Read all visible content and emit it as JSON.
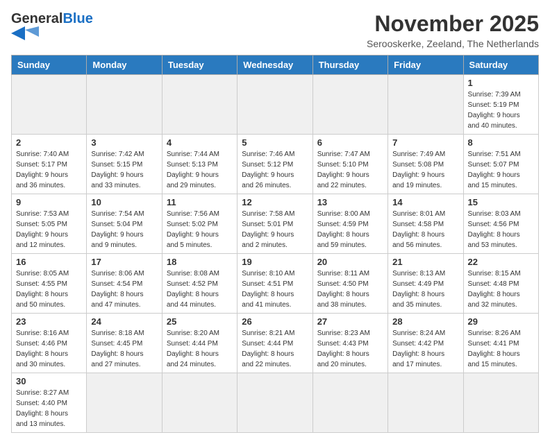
{
  "header": {
    "logo_general": "General",
    "logo_blue": "Blue",
    "title": "November 2025",
    "location": "Serooskerke, Zeeland, The Netherlands"
  },
  "days_of_week": [
    "Sunday",
    "Monday",
    "Tuesday",
    "Wednesday",
    "Thursday",
    "Friday",
    "Saturday"
  ],
  "weeks": [
    [
      {
        "day": "",
        "info": ""
      },
      {
        "day": "",
        "info": ""
      },
      {
        "day": "",
        "info": ""
      },
      {
        "day": "",
        "info": ""
      },
      {
        "day": "",
        "info": ""
      },
      {
        "day": "",
        "info": ""
      },
      {
        "day": "1",
        "info": "Sunrise: 7:39 AM\nSunset: 5:19 PM\nDaylight: 9 hours\nand 40 minutes."
      }
    ],
    [
      {
        "day": "2",
        "info": "Sunrise: 7:40 AM\nSunset: 5:17 PM\nDaylight: 9 hours\nand 36 minutes."
      },
      {
        "day": "3",
        "info": "Sunrise: 7:42 AM\nSunset: 5:15 PM\nDaylight: 9 hours\nand 33 minutes."
      },
      {
        "day": "4",
        "info": "Sunrise: 7:44 AM\nSunset: 5:13 PM\nDaylight: 9 hours\nand 29 minutes."
      },
      {
        "day": "5",
        "info": "Sunrise: 7:46 AM\nSunset: 5:12 PM\nDaylight: 9 hours\nand 26 minutes."
      },
      {
        "day": "6",
        "info": "Sunrise: 7:47 AM\nSunset: 5:10 PM\nDaylight: 9 hours\nand 22 minutes."
      },
      {
        "day": "7",
        "info": "Sunrise: 7:49 AM\nSunset: 5:08 PM\nDaylight: 9 hours\nand 19 minutes."
      },
      {
        "day": "8",
        "info": "Sunrise: 7:51 AM\nSunset: 5:07 PM\nDaylight: 9 hours\nand 15 minutes."
      }
    ],
    [
      {
        "day": "9",
        "info": "Sunrise: 7:53 AM\nSunset: 5:05 PM\nDaylight: 9 hours\nand 12 minutes."
      },
      {
        "day": "10",
        "info": "Sunrise: 7:54 AM\nSunset: 5:04 PM\nDaylight: 9 hours\nand 9 minutes."
      },
      {
        "day": "11",
        "info": "Sunrise: 7:56 AM\nSunset: 5:02 PM\nDaylight: 9 hours\nand 5 minutes."
      },
      {
        "day": "12",
        "info": "Sunrise: 7:58 AM\nSunset: 5:01 PM\nDaylight: 9 hours\nand 2 minutes."
      },
      {
        "day": "13",
        "info": "Sunrise: 8:00 AM\nSunset: 4:59 PM\nDaylight: 8 hours\nand 59 minutes."
      },
      {
        "day": "14",
        "info": "Sunrise: 8:01 AM\nSunset: 4:58 PM\nDaylight: 8 hours\nand 56 minutes."
      },
      {
        "day": "15",
        "info": "Sunrise: 8:03 AM\nSunset: 4:56 PM\nDaylight: 8 hours\nand 53 minutes."
      }
    ],
    [
      {
        "day": "16",
        "info": "Sunrise: 8:05 AM\nSunset: 4:55 PM\nDaylight: 8 hours\nand 50 minutes."
      },
      {
        "day": "17",
        "info": "Sunrise: 8:06 AM\nSunset: 4:54 PM\nDaylight: 8 hours\nand 47 minutes."
      },
      {
        "day": "18",
        "info": "Sunrise: 8:08 AM\nSunset: 4:52 PM\nDaylight: 8 hours\nand 44 minutes."
      },
      {
        "day": "19",
        "info": "Sunrise: 8:10 AM\nSunset: 4:51 PM\nDaylight: 8 hours\nand 41 minutes."
      },
      {
        "day": "20",
        "info": "Sunrise: 8:11 AM\nSunset: 4:50 PM\nDaylight: 8 hours\nand 38 minutes."
      },
      {
        "day": "21",
        "info": "Sunrise: 8:13 AM\nSunset: 4:49 PM\nDaylight: 8 hours\nand 35 minutes."
      },
      {
        "day": "22",
        "info": "Sunrise: 8:15 AM\nSunset: 4:48 PM\nDaylight: 8 hours\nand 32 minutes."
      }
    ],
    [
      {
        "day": "23",
        "info": "Sunrise: 8:16 AM\nSunset: 4:46 PM\nDaylight: 8 hours\nand 30 minutes."
      },
      {
        "day": "24",
        "info": "Sunrise: 8:18 AM\nSunset: 4:45 PM\nDaylight: 8 hours\nand 27 minutes."
      },
      {
        "day": "25",
        "info": "Sunrise: 8:20 AM\nSunset: 4:44 PM\nDaylight: 8 hours\nand 24 minutes."
      },
      {
        "day": "26",
        "info": "Sunrise: 8:21 AM\nSunset: 4:44 PM\nDaylight: 8 hours\nand 22 minutes."
      },
      {
        "day": "27",
        "info": "Sunrise: 8:23 AM\nSunset: 4:43 PM\nDaylight: 8 hours\nand 20 minutes."
      },
      {
        "day": "28",
        "info": "Sunrise: 8:24 AM\nSunset: 4:42 PM\nDaylight: 8 hours\nand 17 minutes."
      },
      {
        "day": "29",
        "info": "Sunrise: 8:26 AM\nSunset: 4:41 PM\nDaylight: 8 hours\nand 15 minutes."
      }
    ],
    [
      {
        "day": "30",
        "info": "Sunrise: 8:27 AM\nSunset: 4:40 PM\nDaylight: 8 hours\nand 13 minutes."
      },
      {
        "day": "",
        "info": ""
      },
      {
        "day": "",
        "info": ""
      },
      {
        "day": "",
        "info": ""
      },
      {
        "day": "",
        "info": ""
      },
      {
        "day": "",
        "info": ""
      },
      {
        "day": "",
        "info": ""
      }
    ]
  ]
}
